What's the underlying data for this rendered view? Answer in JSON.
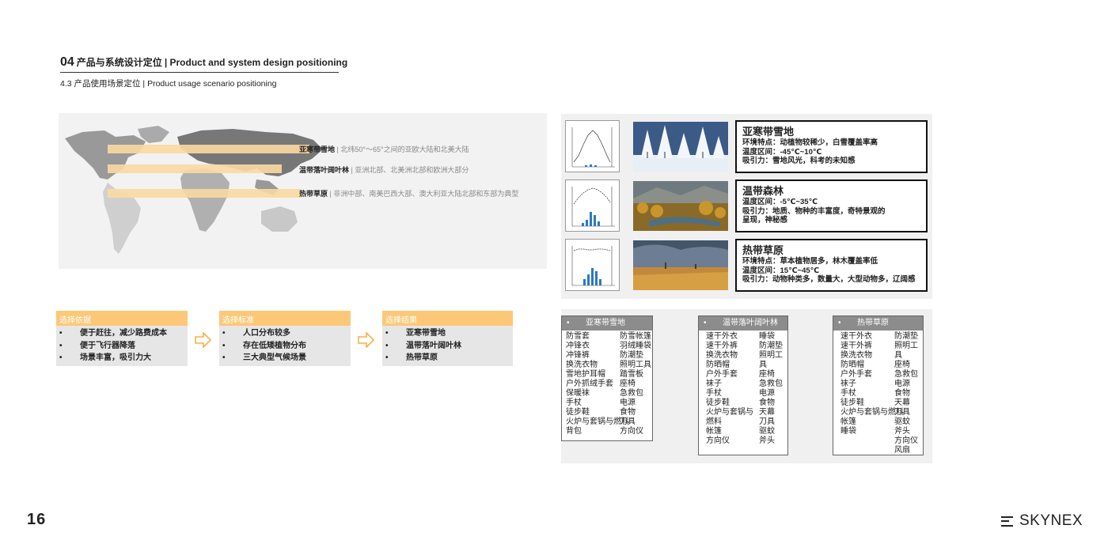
{
  "header": {
    "section_num": "04",
    "title": "产品与系统设计定位",
    "title_en": "| Product and system design positioning",
    "subtitle": "4.3 产品使用场景定位 | Product usage scenario positioning"
  },
  "map": {
    "bands": [
      {
        "name": "亚寒带雪地",
        "desc": "北纬50°～65°之间的亚欧大陆和北美大陆"
      },
      {
        "name": "温带落叶阔叶林",
        "desc": "亚洲北部、北美洲北部和欧洲大部分"
      },
      {
        "name": "热带草原",
        "desc": "非洲中部、南美巴西大部、澳大利亚大陆北部和东部为典型"
      }
    ]
  },
  "climates": [
    {
      "title": "亚寒带雪地",
      "lines": [
        "环境特点：动植物较稀少，白雪覆盖率高",
        "温度区间：-45℃~10℃",
        "吸引力：雪地风光，科考的未知感"
      ]
    },
    {
      "title": "温带森林",
      "lines": [
        "温度区间：-5℃~35℃",
        "吸引力：地质、物种的丰富度，奇特景观的",
        "呈现，神秘感"
      ]
    },
    {
      "title": "热带草原",
      "lines": [
        "环境特点：草本植物居多，林木覆盖率低",
        "温度区间：15℃~45℃",
        "吸引力：动物种类多，数量大，大型动物多，辽阔感"
      ]
    }
  ],
  "flow": [
    {
      "head": "选择依据",
      "items": [
        "便于赶往，减少路费成本",
        "便于飞行器降落",
        "场景丰富，吸引力大"
      ]
    },
    {
      "head": "选择标准",
      "items": [
        "人口分布较多",
        "存在低矮植物分布",
        "三大典型气候场景"
      ]
    },
    {
      "head": "选择结果",
      "items": [
        "亚寒带雪地",
        "温带落叶阔叶林",
        "热带草原"
      ]
    }
  ],
  "bullet": "•",
  "gear": [
    {
      "head": "亚寒带雪地",
      "left": [
        "防雪套",
        "冲锋衣",
        "冲锋裤",
        "换洗衣物",
        "雪地护耳帽",
        "户外抓绒手套",
        "保暖袜",
        "手杖",
        "徒步鞋",
        "火炉与套锅与燃料",
        "背包"
      ],
      "right": [
        "防雪帐篷",
        "羽绒睡袋",
        "防潮垫",
        "照明工具",
        "踏雪板",
        "座椅",
        "急救包",
        "电源",
        "食物",
        "刀具",
        "方向仪"
      ]
    },
    {
      "head": "温带落叶阔叶林",
      "left": [
        "速干外衣",
        "速干外裤",
        "换洗衣物",
        "防晒帽",
        "户外手套",
        "袜子",
        "手杖",
        "徒步鞋",
        "火炉与套锅与",
        "燃料",
        "帐篷",
        "方向仪"
      ],
      "right": [
        "睡袋",
        "防潮垫",
        "照明工",
        "具",
        "座椅",
        "急救包",
        "电源",
        "食物",
        "天幕",
        "刀具",
        "驱蚊",
        "斧头"
      ]
    },
    {
      "head": "热带草原",
      "left": [
        "速干外衣",
        "速干外裤",
        "换洗衣物",
        "防晒帽",
        "户外手套",
        "袜子",
        "手杖",
        "徒步鞋",
        "火炉与套锅与燃料",
        "帐篷",
        "睡袋"
      ],
      "right": [
        "防潮垫",
        "照明工",
        "具",
        "座椅",
        "急救包",
        "电源",
        "食物",
        "天幕",
        "刀具",
        "驱蚊",
        "斧头",
        "方向仪",
        "风扇"
      ]
    }
  ],
  "page_number": "16",
  "brand": "SKYNEX",
  "colors": {
    "accent": "#fcc878",
    "band": "#fbd9a2",
    "gear_head": "#8c8c8c"
  }
}
